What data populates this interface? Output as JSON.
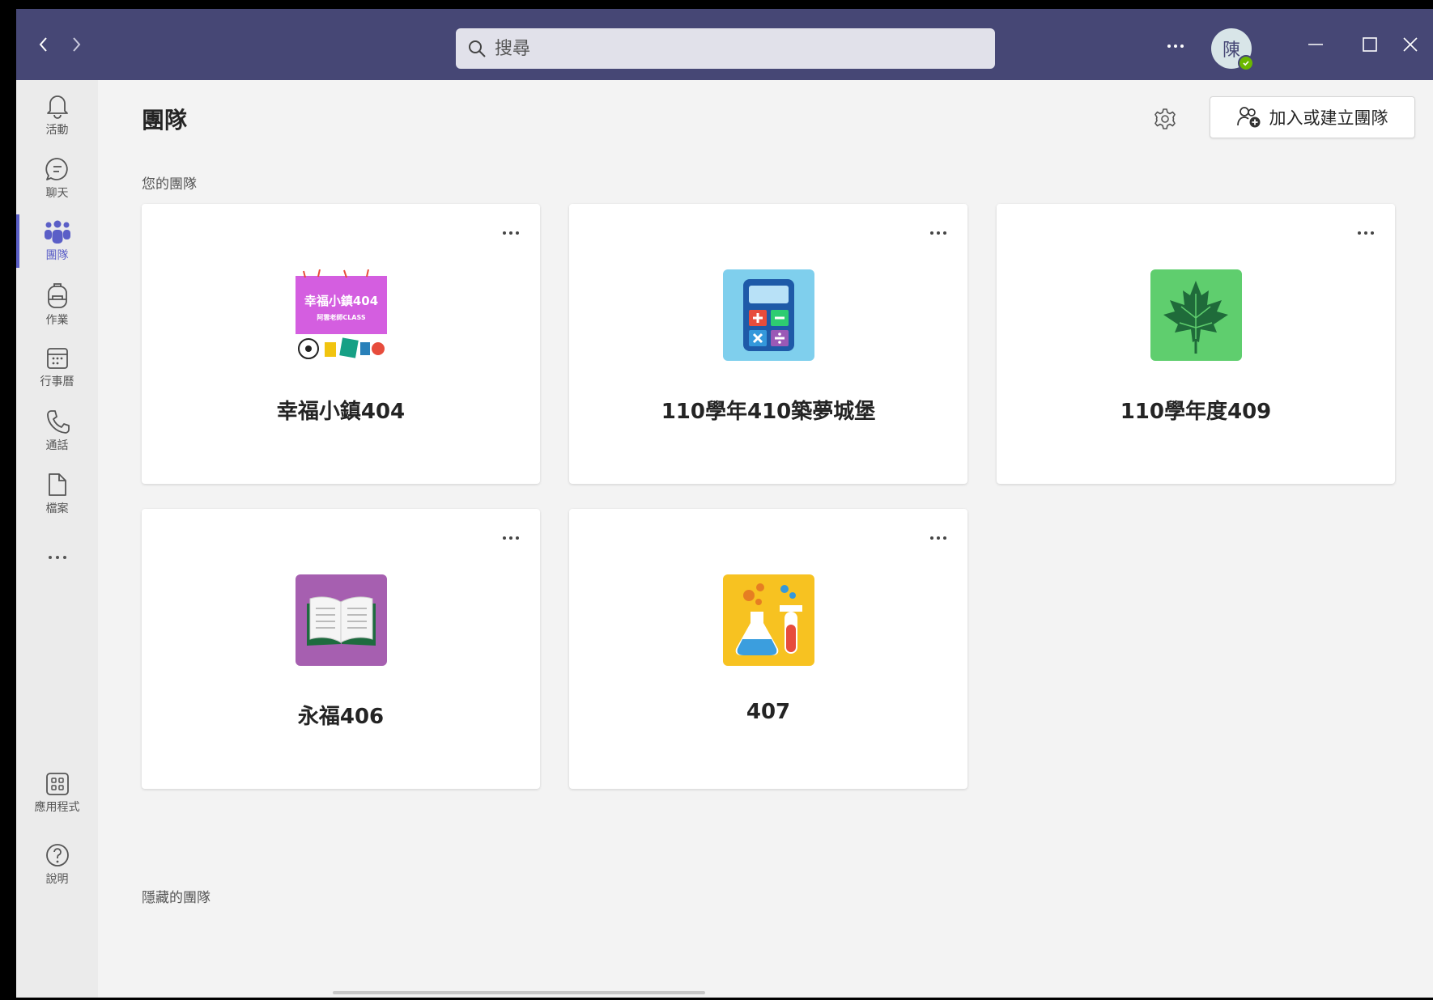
{
  "titlebar": {
    "search_placeholder": "搜尋",
    "avatar_initial": "陳",
    "colors": {
      "bar": "#464775",
      "presence": "#6bb700"
    }
  },
  "rail": {
    "items": [
      {
        "label": "活動",
        "icon": "bell-icon"
      },
      {
        "label": "聊天",
        "icon": "chat-icon"
      },
      {
        "label": "團隊",
        "icon": "teams-icon",
        "active": true
      },
      {
        "label": "作業",
        "icon": "backpack-icon"
      },
      {
        "label": "行事曆",
        "icon": "calendar-icon"
      },
      {
        "label": "通話",
        "icon": "phone-icon"
      },
      {
        "label": "檔案",
        "icon": "file-icon"
      }
    ],
    "bottom_items": [
      {
        "label": "應用程式",
        "icon": "apps-icon"
      },
      {
        "label": "說明",
        "icon": "help-icon"
      }
    ]
  },
  "main": {
    "title": "團隊",
    "join_button_label": "加入或建立團隊",
    "your_teams_label": "您的團隊",
    "hidden_teams_label": "隱藏的團隊",
    "teams": [
      {
        "name": "幸福小鎮404",
        "image": "custom-class-banner",
        "banner_title": "幸福小鎮404",
        "banner_subtitle": "阿雲老師CLASS"
      },
      {
        "name": "110學年410築夢城堡",
        "image": "calculator-icon"
      },
      {
        "name": "110學年度409",
        "image": "maple-leaf-icon"
      },
      {
        "name": "永福406",
        "image": "open-book-icon"
      },
      {
        "name": "407",
        "image": "science-flask-icon"
      }
    ]
  }
}
